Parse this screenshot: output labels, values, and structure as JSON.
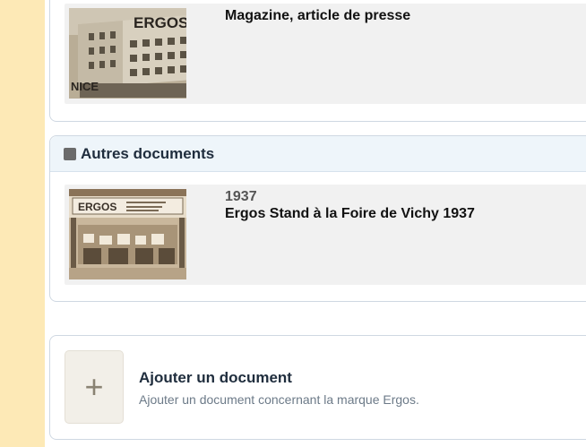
{
  "top_section": {
    "document": {
      "title": "Magazine, article de presse",
      "thumbnail_sign": "ERGOS",
      "thumbnail_city": "NICE"
    }
  },
  "other_docs": {
    "header": "Autres documents",
    "header_icon": "square-icon",
    "documents": [
      {
        "year": "1937",
        "title": "Ergos Stand à la Foire de Vichy 1937",
        "thumbnail_sign": "ERGOS"
      }
    ]
  },
  "add_document": {
    "title": "Ajouter un document",
    "description": "Ajouter un document concernant la marque Ergos.",
    "button_symbol": "+",
    "button_icon": "plus-icon"
  },
  "colors": {
    "side_strip": "#fde9b6",
    "header_bg": "#eef5fa",
    "row_bg": "#f1f1f1",
    "border": "#cfd8e2"
  }
}
